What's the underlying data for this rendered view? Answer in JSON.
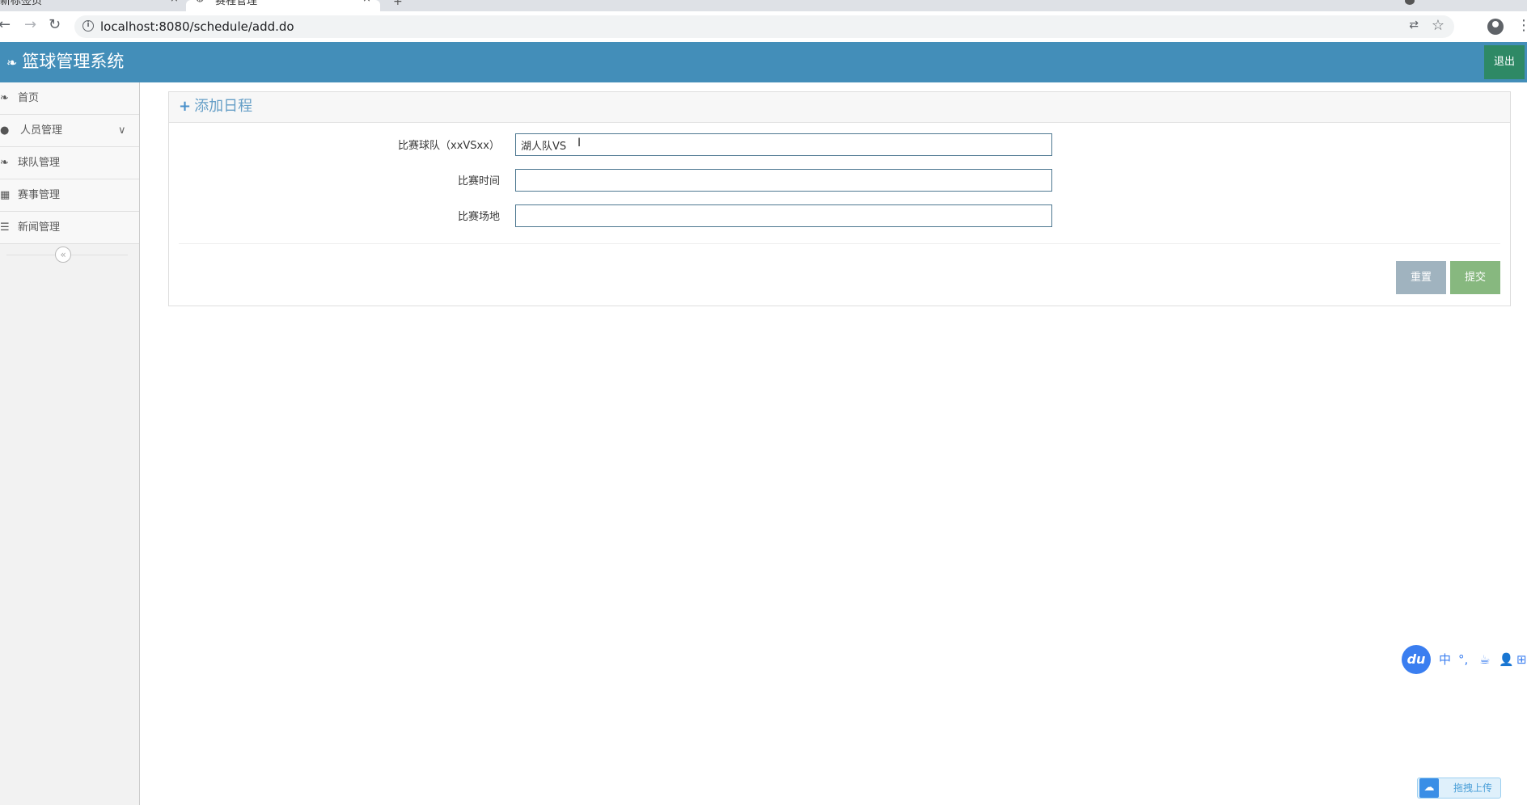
{
  "browser": {
    "tabs": [
      {
        "label": "新标签页",
        "close": "×"
      },
      {
        "label": "赛程管理",
        "close": "×"
      }
    ],
    "new_tab": "+",
    "url": "localhost:8080/schedule/add.do"
  },
  "header": {
    "brand": "篮球管理系统",
    "logout": "退出"
  },
  "sidebar": {
    "items": [
      {
        "label": "首页"
      },
      {
        "label": "人员管理"
      },
      {
        "label": "球队管理"
      },
      {
        "label": "赛事管理"
      },
      {
        "label": "新闻管理"
      }
    ]
  },
  "panel": {
    "title": "添加日程",
    "fields": [
      {
        "label": "比赛球队（xxVSxx）",
        "value": ""
      },
      {
        "label": "比赛时间",
        "value": ""
      },
      {
        "label": "比赛场地",
        "value": ""
      }
    ],
    "team_value": "湖人队VS",
    "reset": "重置",
    "submit": "提交"
  },
  "widgets": {
    "ime_logo": "du",
    "ime_items": [
      "中",
      "°,",
      "☕",
      "👤",
      "⊞"
    ],
    "upload": "拖拽上传"
  },
  "colors": {
    "header_bg": "#438eb9",
    "logout_bg": "#2e8965",
    "reset_bg": "#a0b3bf",
    "submit_bg": "#87b87f"
  }
}
